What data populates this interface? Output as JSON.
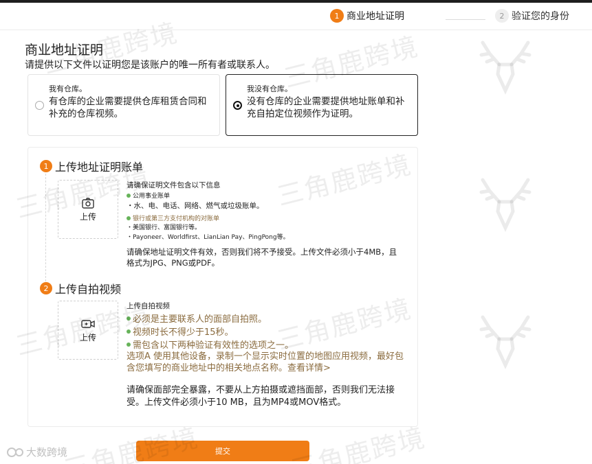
{
  "stepper": {
    "steps": [
      {
        "num": "1",
        "label": "商业地址证明"
      },
      {
        "num": "2",
        "label": "验证您的身份"
      }
    ]
  },
  "page": {
    "title": "商业地址证明",
    "subtitle": "请提供以下文件以证明您是该账户的唯一所有者或联系人。"
  },
  "options": [
    {
      "title": "我有仓库。",
      "desc": "有仓库的企业需要提供仓库租赁合同和补充的仓库视频。",
      "selected": false
    },
    {
      "title": "我没有仓库。",
      "desc": "没有仓库的企业需要提供地址账单和补充自拍定位视频作为证明。",
      "selected": true
    }
  ],
  "section1": {
    "num": "1",
    "heading": "上传地址证明账单",
    "upload_label": "上传",
    "req_title": "请确保证明文件包含以下信息",
    "item_a": "公用事业账单",
    "item_a_detail": "・水、电、电话、网络、燃气或垃圾账单。",
    "item_b": "银行或第三方支付机构的对账单",
    "item_b_detail1": "・美国银行、富国银行等。",
    "item_b_detail2": "・Payoneer、Worldfirst、LianLian Pay、PingPong等。",
    "note": "请确保地址证明文件有效，否则我们将不予接受。上传文件必须小于4MB，且格式为JPG、PNG或PDF。"
  },
  "section2": {
    "num": "2",
    "heading": "上传自拍视频",
    "upload_label": "上传",
    "req_title": "上传自拍视频",
    "check1": "必须是主要联系人的面部自拍照。",
    "check2": "视频时长不得少于15秒。",
    "check3": "需包含以下两种验证有效性的选项之一。",
    "option_a": "选项A 使用其他设备，录制一个显示实时位置的地图应用视频，最好包含您填写的商业地址中的相关地点名称。查看详情>",
    "note": "请确保面部完全暴露，不要从上方拍摄或遮挡面部，否则我们无法接受。上传文件必须小于10 MB，且为MP4或MOV格式。"
  },
  "submit_label": "提交",
  "watermark": {
    "text": "三角鹿跨境",
    "footer": "大数跨境"
  },
  "colors": {
    "accent": "#f07d16",
    "check": "#67b35a",
    "brown": "#8a6b3e"
  }
}
